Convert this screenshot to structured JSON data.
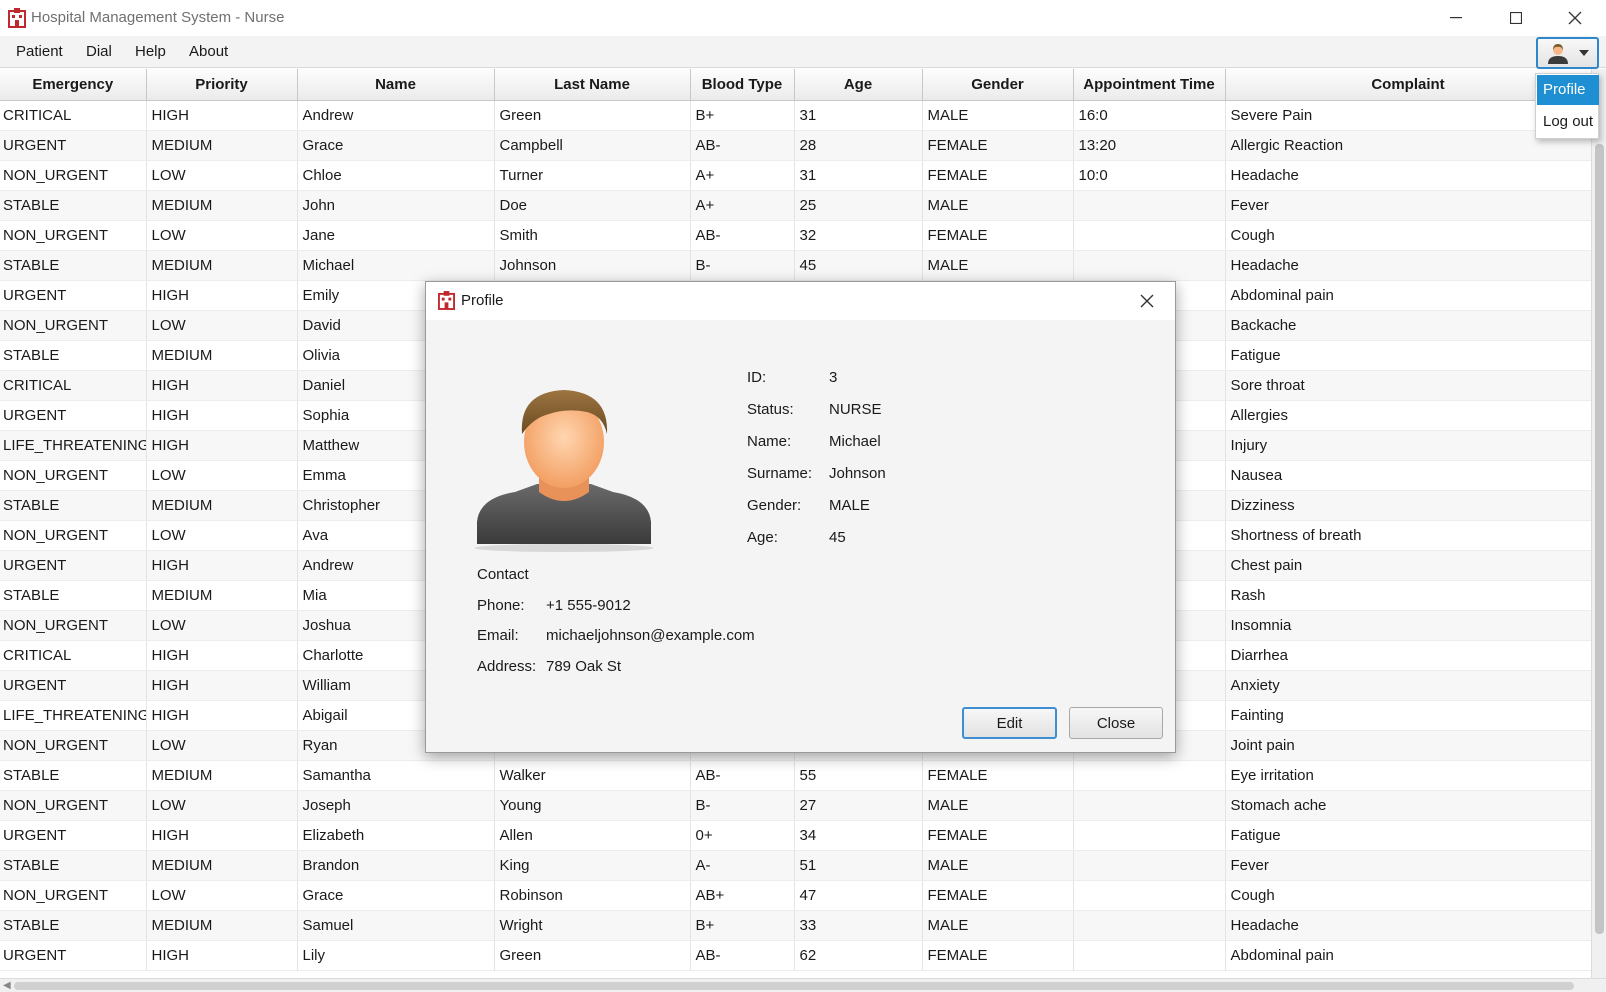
{
  "window": {
    "title": "Hospital Management System - Nurse"
  },
  "menu": [
    "Patient",
    "Dial",
    "Help",
    "About"
  ],
  "user_menu": {
    "items": [
      "Profile",
      "Log out"
    ],
    "selected": "Profile"
  },
  "table": {
    "columns": [
      "Emergency",
      "Priority",
      "Name",
      "Last Name",
      "Blood Type",
      "Age",
      "Gender",
      "Appointment Time",
      "Complaint"
    ],
    "rows": [
      [
        "CRITICAL",
        "HIGH",
        "Andrew",
        "Green",
        "B+",
        "31",
        "MALE",
        "16:0",
        "Severe Pain"
      ],
      [
        "URGENT",
        "MEDIUM",
        "Grace",
        "Campbell",
        "AB-",
        "28",
        "FEMALE",
        "13:20",
        "Allergic Reaction"
      ],
      [
        "NON_URGENT",
        "LOW",
        "Chloe",
        "Turner",
        "A+",
        "31",
        "FEMALE",
        "10:0",
        "Headache"
      ],
      [
        "STABLE",
        "MEDIUM",
        "John",
        "Doe",
        "A+",
        "25",
        "MALE",
        "",
        "Fever"
      ],
      [
        "NON_URGENT",
        "LOW",
        "Jane",
        "Smith",
        "AB-",
        "32",
        "FEMALE",
        "",
        "Cough"
      ],
      [
        "STABLE",
        "MEDIUM",
        "Michael",
        "Johnson",
        "B-",
        "45",
        "MALE",
        "",
        "Headache"
      ],
      [
        "URGENT",
        "HIGH",
        "Emily",
        "",
        "",
        "",
        "",
        "",
        "Abdominal pain"
      ],
      [
        "NON_URGENT",
        "LOW",
        "David",
        "",
        "",
        "",
        "",
        "",
        "Backache"
      ],
      [
        "STABLE",
        "MEDIUM",
        "Olivia",
        "",
        "",
        "",
        "",
        "",
        "Fatigue"
      ],
      [
        "CRITICAL",
        "HIGH",
        "Daniel",
        "",
        "",
        "",
        "",
        "",
        "Sore throat"
      ],
      [
        "URGENT",
        "HIGH",
        "Sophia",
        "",
        "",
        "",
        "",
        "",
        "Allergies"
      ],
      [
        "LIFE_THREATENING",
        "HIGH",
        "Matthew",
        "",
        "",
        "",
        "",
        "",
        "Injury"
      ],
      [
        "NON_URGENT",
        "LOW",
        "Emma",
        "",
        "",
        "",
        "",
        "",
        "Nausea"
      ],
      [
        "STABLE",
        "MEDIUM",
        "Christopher",
        "",
        "",
        "",
        "",
        "",
        "Dizziness"
      ],
      [
        "NON_URGENT",
        "LOW",
        "Ava",
        "",
        "",
        "",
        "",
        "",
        "Shortness of breath"
      ],
      [
        "URGENT",
        "HIGH",
        "Andrew",
        "",
        "",
        "",
        "",
        "",
        "Chest pain"
      ],
      [
        "STABLE",
        "MEDIUM",
        "Mia",
        "",
        "",
        "",
        "",
        "",
        "Rash"
      ],
      [
        "NON_URGENT",
        "LOW",
        "Joshua",
        "",
        "",
        "",
        "",
        "",
        "Insomnia"
      ],
      [
        "CRITICAL",
        "HIGH",
        "Charlotte",
        "",
        "",
        "",
        "",
        "",
        "Diarrhea"
      ],
      [
        "URGENT",
        "HIGH",
        "William",
        "",
        "",
        "",
        "",
        "",
        "Anxiety"
      ],
      [
        "LIFE_THREATENING",
        "HIGH",
        "Abigail",
        "",
        "",
        "",
        "",
        "",
        "Fainting"
      ],
      [
        "NON_URGENT",
        "LOW",
        "Ryan",
        "",
        "",
        "",
        "",
        "",
        "Joint pain"
      ],
      [
        "STABLE",
        "MEDIUM",
        "Samantha",
        "Walker",
        "AB-",
        "55",
        "FEMALE",
        "",
        "Eye irritation"
      ],
      [
        "NON_URGENT",
        "LOW",
        "Joseph",
        "Young",
        "B-",
        "27",
        "MALE",
        "",
        "Stomach ache"
      ],
      [
        "URGENT",
        "HIGH",
        "Elizabeth",
        "Allen",
        "0+",
        "34",
        "FEMALE",
        "",
        "Fatigue"
      ],
      [
        "STABLE",
        "MEDIUM",
        "Brandon",
        "King",
        "A-",
        "51",
        "MALE",
        "",
        "Fever"
      ],
      [
        "NON_URGENT",
        "LOW",
        "Grace",
        "Robinson",
        "AB+",
        "47",
        "FEMALE",
        "",
        "Cough"
      ],
      [
        "STABLE",
        "MEDIUM",
        "Samuel",
        "Wright",
        "B+",
        "33",
        "MALE",
        "",
        "Headache"
      ],
      [
        "URGENT",
        "HIGH",
        "Lily",
        "Green",
        "AB-",
        "62",
        "FEMALE",
        "",
        "Abdominal pain"
      ]
    ]
  },
  "profile_dialog": {
    "title": "Profile",
    "fields": [
      {
        "label": "ID:",
        "value": "3"
      },
      {
        "label": "Status:",
        "value": "NURSE"
      },
      {
        "label": "Name:",
        "value": "Michael"
      },
      {
        "label": "Surname:",
        "value": "Johnson"
      },
      {
        "label": "Gender:",
        "value": "MALE"
      },
      {
        "label": "Age:",
        "value": "45"
      }
    ],
    "contact_heading": "Contact",
    "contact": [
      {
        "label": "Phone:",
        "value": "+1 555-9012"
      },
      {
        "label": "Email:",
        "value": "michaeljohnson@example.com"
      },
      {
        "label": "Address:",
        "value": "789 Oak St"
      }
    ],
    "edit_label": "Edit",
    "close_label": "Close"
  },
  "colors": {
    "accent": "#1f8fd4",
    "app_icon": "#c0282d"
  },
  "icons": {
    "app": "hospital-building-icon",
    "user": "user-avatar-icon",
    "close": "close-icon"
  }
}
